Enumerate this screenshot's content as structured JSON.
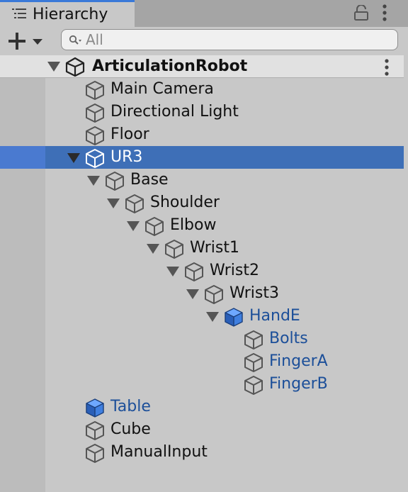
{
  "tab": {
    "title": "Hierarchy",
    "icon": "hierarchy-list-icon"
  },
  "toolbar": {
    "add_icon": "plus-icon",
    "search_placeholder": "All",
    "search_value": ""
  },
  "scene": {
    "name": "ArticulationRobot",
    "icon": "unity-logo-icon"
  },
  "rows": [
    {
      "name": "Main Camera",
      "depth": 0,
      "icon": "cube-icon",
      "prefab": false,
      "expanded": null,
      "selected": false
    },
    {
      "name": "Directional Light",
      "depth": 0,
      "icon": "cube-icon",
      "prefab": false,
      "expanded": null,
      "selected": false
    },
    {
      "name": "Floor",
      "depth": 0,
      "icon": "cube-icon",
      "prefab": false,
      "expanded": null,
      "selected": false
    },
    {
      "name": "UR3",
      "depth": 0,
      "icon": "cube-icon",
      "prefab": false,
      "expanded": true,
      "selected": true
    },
    {
      "name": "Base",
      "depth": 1,
      "icon": "cube-icon",
      "prefab": false,
      "expanded": true,
      "selected": false
    },
    {
      "name": "Shoulder",
      "depth": 2,
      "icon": "cube-icon",
      "prefab": false,
      "expanded": true,
      "selected": false
    },
    {
      "name": "Elbow",
      "depth": 3,
      "icon": "cube-icon",
      "prefab": false,
      "expanded": true,
      "selected": false
    },
    {
      "name": "Wrist1",
      "depth": 4,
      "icon": "cube-icon",
      "prefab": false,
      "expanded": true,
      "selected": false
    },
    {
      "name": "Wrist2",
      "depth": 5,
      "icon": "cube-icon",
      "prefab": false,
      "expanded": true,
      "selected": false
    },
    {
      "name": "Wrist3",
      "depth": 6,
      "icon": "cube-icon",
      "prefab": false,
      "expanded": true,
      "selected": false
    },
    {
      "name": "HandE",
      "depth": 7,
      "icon": "prefab-cube-icon",
      "prefab": true,
      "expanded": true,
      "selected": false
    },
    {
      "name": "Bolts",
      "depth": 8,
      "icon": "cube-icon",
      "prefab": true,
      "expanded": null,
      "selected": false
    },
    {
      "name": "FingerA",
      "depth": 8,
      "icon": "cube-icon",
      "prefab": true,
      "expanded": null,
      "selected": false
    },
    {
      "name": "FingerB",
      "depth": 8,
      "icon": "cube-icon",
      "prefab": true,
      "expanded": null,
      "selected": false
    },
    {
      "name": "Table",
      "depth": 0,
      "icon": "prefab-cube-icon",
      "prefab": true,
      "expanded": null,
      "selected": false
    },
    {
      "name": "Cube",
      "depth": 0,
      "icon": "cube-icon",
      "prefab": false,
      "expanded": null,
      "selected": false
    },
    {
      "name": "ManualInput",
      "depth": 0,
      "icon": "cube-icon",
      "prefab": false,
      "expanded": null,
      "selected": false
    }
  ],
  "colors": {
    "selection": "#3e6fb7",
    "prefab_text": "#1c4f99",
    "tab_accent": "#3a79d8"
  }
}
